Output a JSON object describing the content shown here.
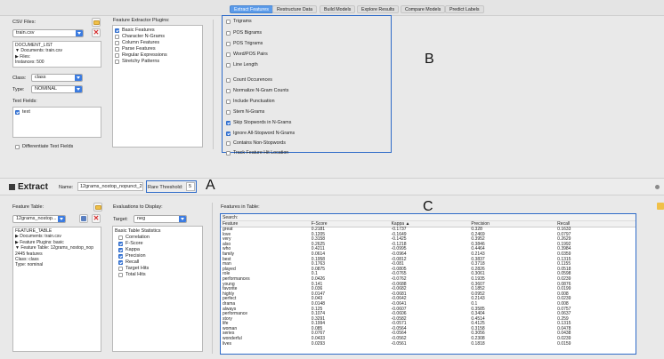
{
  "tabs": [
    {
      "label": "Extract Features",
      "active": true
    },
    {
      "label": "Restructure Data",
      "active": false
    },
    {
      "label": "Build Models",
      "active": false
    },
    {
      "label": "Explore Results",
      "active": false
    },
    {
      "label": "Compare Models",
      "active": false
    },
    {
      "label": "Predict Labels",
      "active": false
    }
  ],
  "csv": {
    "label": "CSV Files:",
    "file": "train.csv",
    "tree": [
      "DOCUMENT_LIST",
      "▼  Documents: train.csv",
      "      ▶  Files:",
      "      Instances: 500"
    ]
  },
  "class_field": {
    "label": "Class:",
    "value": "class"
  },
  "type_field": {
    "label": "Type:",
    "value": "NOMINAL"
  },
  "text_fields": {
    "label": "Text Fields:",
    "items": [
      {
        "label": "text",
        "checked": true
      }
    ]
  },
  "differentiate": {
    "label": "Differentiate Text Fields",
    "checked": false
  },
  "plugins": {
    "label": "Feature Extractor Plugins:",
    "items": [
      {
        "label": "Basic Features",
        "checked": true
      },
      {
        "label": "Character N-Grams",
        "checked": false
      },
      {
        "label": "Column Features",
        "checked": false
      },
      {
        "label": "Parse Features",
        "checked": false
      },
      {
        "label": "Regular Expressions",
        "checked": false
      },
      {
        "label": "Stretchy Patterns",
        "checked": false
      }
    ]
  },
  "options": [
    {
      "label": "Trigrams",
      "checked": false
    },
    {
      "label": "POS Bigrams",
      "checked": false
    },
    {
      "label": "POS Trigrams",
      "checked": false
    },
    {
      "label": "Word/POS Pairs",
      "checked": false
    },
    {
      "label": "Line Length",
      "checked": false
    },
    {
      "label": "Count Occurences",
      "checked": false
    },
    {
      "label": "Normalize N-Gram Counts",
      "checked": false
    },
    {
      "label": "Include Punctuation",
      "checked": false
    },
    {
      "label": "Stem N-Grams",
      "checked": false
    },
    {
      "label": "Skip Stopwords in N-Grams",
      "checked": true
    },
    {
      "label": "Ignore All-Stopword N-Grams",
      "checked": true
    },
    {
      "label": "Contains Non-Stopwords",
      "checked": false
    },
    {
      "label": "Track Feature Hit Location",
      "checked": false
    }
  ],
  "annotations": {
    "a": "A",
    "b": "B",
    "c": "C"
  },
  "extract": {
    "button": "Extract",
    "name_label": "Name:",
    "name_value": "12grams_nostop_nopunct_2",
    "threshold_label": "Rare Threshold:",
    "threshold_value": "5"
  },
  "feature_table": {
    "label": "Feature Table:",
    "value": "12grams_nostop...",
    "tree": [
      "FEATURE_TABLE",
      "▶  Documents: train.csv",
      "▶  Feature Plugins: basic",
      "▼  Feature Table: 12grams_nostop_nop",
      "      2445 features",
      "      Class: class",
      "      Type: nominal"
    ]
  },
  "evaluations": {
    "label": "Evaluations to Display:",
    "target_label": "Target:",
    "target_value": "neg",
    "items": [
      {
        "label": "Basic Table Statistics",
        "checked": null
      },
      {
        "label": "Correlation",
        "checked": false
      },
      {
        "label": "F-Score",
        "checked": true
      },
      {
        "label": "Kappa",
        "checked": true
      },
      {
        "label": "Precision",
        "checked": true
      },
      {
        "label": "Recall",
        "checked": true
      },
      {
        "label": "Target Hits",
        "checked": false
      },
      {
        "label": "Total Hits",
        "checked": false
      }
    ]
  },
  "features_in_table": {
    "label": "Features in Table:",
    "search": "Search:",
    "headers": [
      "Feature",
      "F-Score",
      "Kappa  ▲",
      "Precision",
      "Recall"
    ],
    "rows": [
      [
        "great",
        "0.2181",
        "-0.1737",
        "0.328",
        "0.1633"
      ],
      [
        "love",
        "0.1205",
        "-0.1649",
        "0.2469",
        "0.0797"
      ],
      [
        "very",
        "0.3158",
        "-0.1425",
        "0.3952",
        "0.2629"
      ],
      [
        "also",
        "0.2625",
        "-0.1218",
        "0.3846",
        "0.1992"
      ],
      [
        "who",
        "0.4211",
        "-0.0995",
        "0.4464",
        "0.3984"
      ],
      [
        "family",
        "0.0614",
        "-0.0964",
        "0.2143",
        "0.0359"
      ],
      [
        "best",
        "0.1958",
        "-0.0812",
        "0.3837",
        "0.1315"
      ],
      [
        "man",
        "0.1763",
        "-0.081",
        "0.3718",
        "0.1155"
      ],
      [
        "played",
        "0.0875",
        "-0.0805",
        "0.2826",
        "0.0518"
      ],
      [
        "role",
        "0.1",
        "-0.0765",
        "0.3061",
        "0.0598"
      ],
      [
        "performances",
        "0.0426",
        "-0.0762",
        "0.1935",
        "0.0239"
      ],
      [
        "young",
        "0.141",
        "-0.0688",
        "0.3607",
        "0.0876"
      ],
      [
        "favorite",
        "0.036",
        "-0.0682",
        "0.1852",
        "0.0199"
      ],
      [
        "highly",
        "0.0147",
        "-0.0681",
        "0.0952",
        "0.008"
      ],
      [
        "perfect",
        "0.043",
        "-0.0642",
        "0.2143",
        "0.0239"
      ],
      [
        "drama",
        "0.0148",
        "-0.0641",
        "0.1",
        "0.008"
      ],
      [
        "always",
        "0.125",
        "-0.0607",
        "0.3585",
        "0.0757"
      ],
      [
        "performance",
        "0.1074",
        "-0.0606",
        "0.3404",
        "0.0637"
      ],
      [
        "story",
        "0.3291",
        "-0.0582",
        "0.4514",
        "0.259"
      ],
      [
        "life",
        "0.1994",
        "-0.0571",
        "0.4125",
        "0.1315"
      ],
      [
        "woman",
        "0.085",
        "-0.0564",
        "0.3158",
        "0.0478"
      ],
      [
        "series",
        "0.0767",
        "-0.0564",
        "0.3056",
        "0.0438"
      ],
      [
        "wonderful",
        "0.0433",
        "-0.0562",
        "0.2308",
        "0.0239"
      ],
      [
        "lives",
        "0.0293",
        "-0.0561",
        "0.1818",
        "0.0159"
      ]
    ]
  }
}
